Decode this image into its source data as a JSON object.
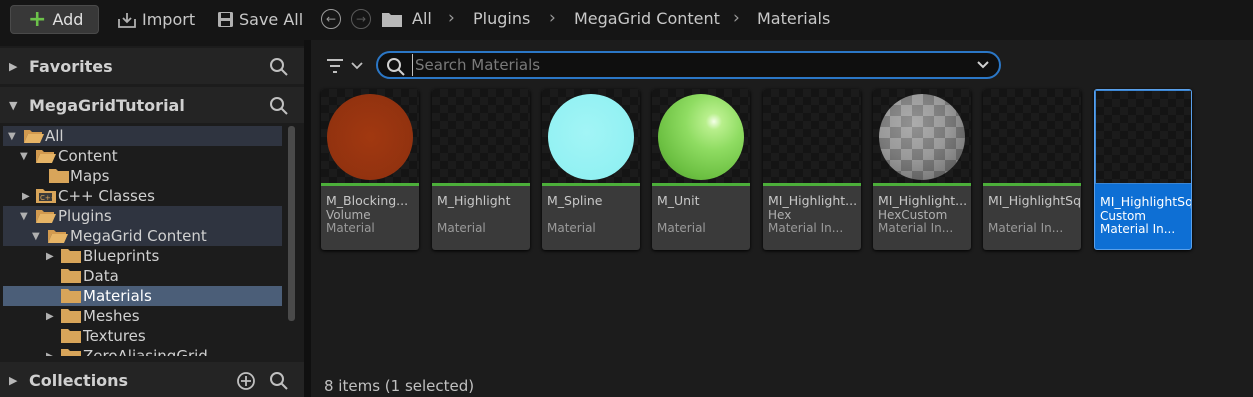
{
  "toolbar": {
    "add_label": "Add",
    "import_label": "Import",
    "save_all_label": "Save All"
  },
  "breadcrumb": [
    "All",
    "Plugins",
    "MegaGrid Content",
    "Materials"
  ],
  "left_panel": {
    "favorites_label": "Favorites",
    "project_label": "MegaGridTutorial",
    "collections_label": "Collections",
    "tree": [
      {
        "label": "All",
        "expanded": true
      },
      {
        "label": "Content",
        "expanded": true
      },
      {
        "label": "Maps"
      },
      {
        "label": "C++ Classes",
        "expanded": false
      },
      {
        "label": "Plugins",
        "expanded": true
      },
      {
        "label": "MegaGrid Content",
        "expanded": true
      },
      {
        "label": "Blueprints",
        "expanded": false
      },
      {
        "label": "Data"
      },
      {
        "label": "Materials",
        "selected": true
      },
      {
        "label": "Meshes",
        "expanded": false
      },
      {
        "label": "Textures"
      },
      {
        "label": "ZeroAliasingGrid"
      }
    ]
  },
  "search": {
    "placeholder": "Search Materials"
  },
  "assets": [
    {
      "name": "M_Blocking...",
      "sub": "Volume",
      "type": "Material",
      "preview_color": "#a13810"
    },
    {
      "name": "M_Highlight",
      "sub": "",
      "type": "Material"
    },
    {
      "name": "M_Spline",
      "sub": "",
      "type": "Material",
      "preview_color": "#8ff0f2"
    },
    {
      "name": "M_Unit",
      "sub": "",
      "type": "Material",
      "preview_color": "#8fdc62"
    },
    {
      "name": "MI_Highlight...",
      "sub": "Hex",
      "type": "Material In..."
    },
    {
      "name": "MI_Highlight...",
      "sub": "HexCustom",
      "type": "Material In...",
      "preview_color": "#8a8a8a"
    },
    {
      "name": "MI_HighlightSq",
      "sub": "",
      "type": "Material In..."
    },
    {
      "name": "MI_HighlightSq...",
      "sub": "Custom",
      "type": "Material In...",
      "selected": true
    }
  ],
  "status_text": "8 items (1 selected)",
  "colors": {
    "accent": "#0e6fd4",
    "material_bar": "#4caf3a",
    "add_plus": "#6cc24a"
  }
}
